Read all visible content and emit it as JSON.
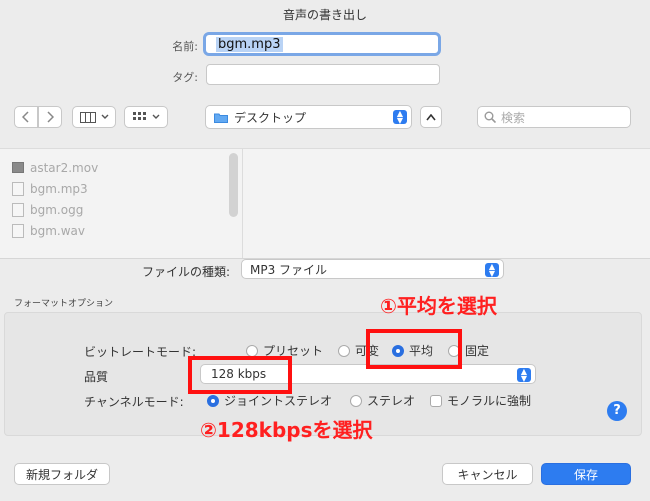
{
  "dialog": {
    "title": "音声の書き出し"
  },
  "name_field": {
    "label": "名前:",
    "value": "bgm.mp3"
  },
  "tags_field": {
    "label": "タグ:",
    "value": ""
  },
  "toolbar": {
    "back_icon": "chevron-left-icon",
    "forward_icon": "chevron-right-icon",
    "location": "デスクトップ",
    "search_placeholder": "検索"
  },
  "files": [
    {
      "name": "astar2.mov",
      "icon": "movie-file-icon"
    },
    {
      "name": "bgm.mp3",
      "icon": "audio-file-icon"
    },
    {
      "name": "bgm.ogg",
      "icon": "audio-file-icon"
    },
    {
      "name": "bgm.wav",
      "icon": "audio-file-icon"
    }
  ],
  "format": {
    "label": "ファイルの種類:",
    "value": "MP3 ファイル"
  },
  "format_options": {
    "heading": "フォーマットオプション",
    "bitrate_mode": {
      "label": "ビットレートモード:",
      "options": [
        "プリセット",
        "可変",
        "平均",
        "固定"
      ],
      "selected": "平均"
    },
    "quality": {
      "label": "品質",
      "value": "128 kbps"
    },
    "channel_mode": {
      "label": "チャンネルモード:",
      "options": [
        "ジョイントステレオ",
        "ステレオ"
      ],
      "selected": "ジョイントステレオ",
      "mono_label": "モノラルに強制"
    }
  },
  "annotations": {
    "step1": "①平均を選択",
    "step2": "②128kbpsを選択",
    "color": "#ff1010"
  },
  "footer": {
    "new_folder": "新規フォルダ",
    "cancel": "キャンセル",
    "save": "保存"
  },
  "colors": {
    "accent": "#2d7cf0"
  }
}
